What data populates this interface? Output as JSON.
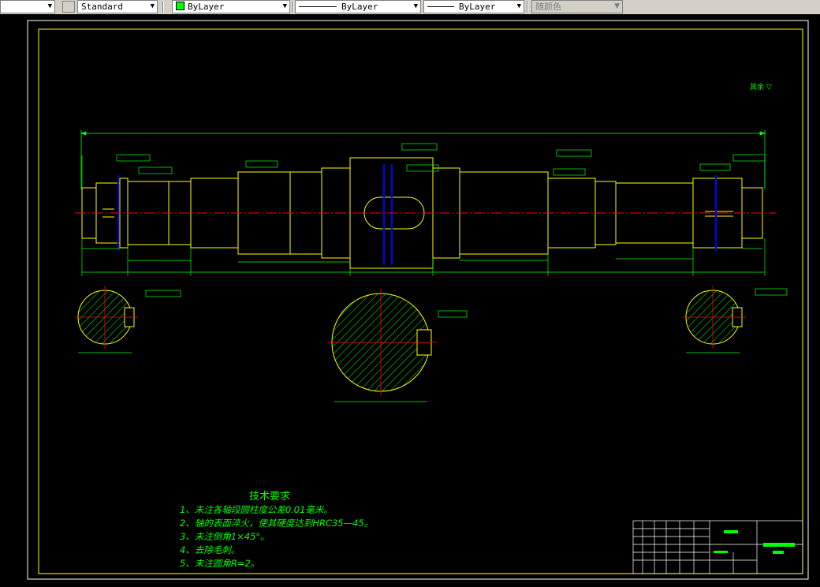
{
  "toolbar": {
    "text_style": "Standard",
    "layer": "ByLayer",
    "linetype": "ByLayer",
    "lineweight": "ByLayer",
    "plot_style": "随颜色",
    "layer_color": "#00ff00"
  },
  "drawing": {
    "roughness_note": "其余",
    "requirements_title": "技术要求",
    "requirements": [
      "1、未注各轴段圆柱度公差0.01毫米。",
      "2、轴的表面淬火，使其硬度达到HRC35—45。",
      "3、未注倒角1×45°。",
      "4、去除毛刺。",
      "5、未注圆角R=2。"
    ],
    "colors": {
      "border": "#ffff00",
      "geometry": "#ffff00",
      "dimension": "#00ff00",
      "centerline": "#ff0000",
      "hidden": "#0000ff",
      "hatch": "#00ff00"
    }
  }
}
